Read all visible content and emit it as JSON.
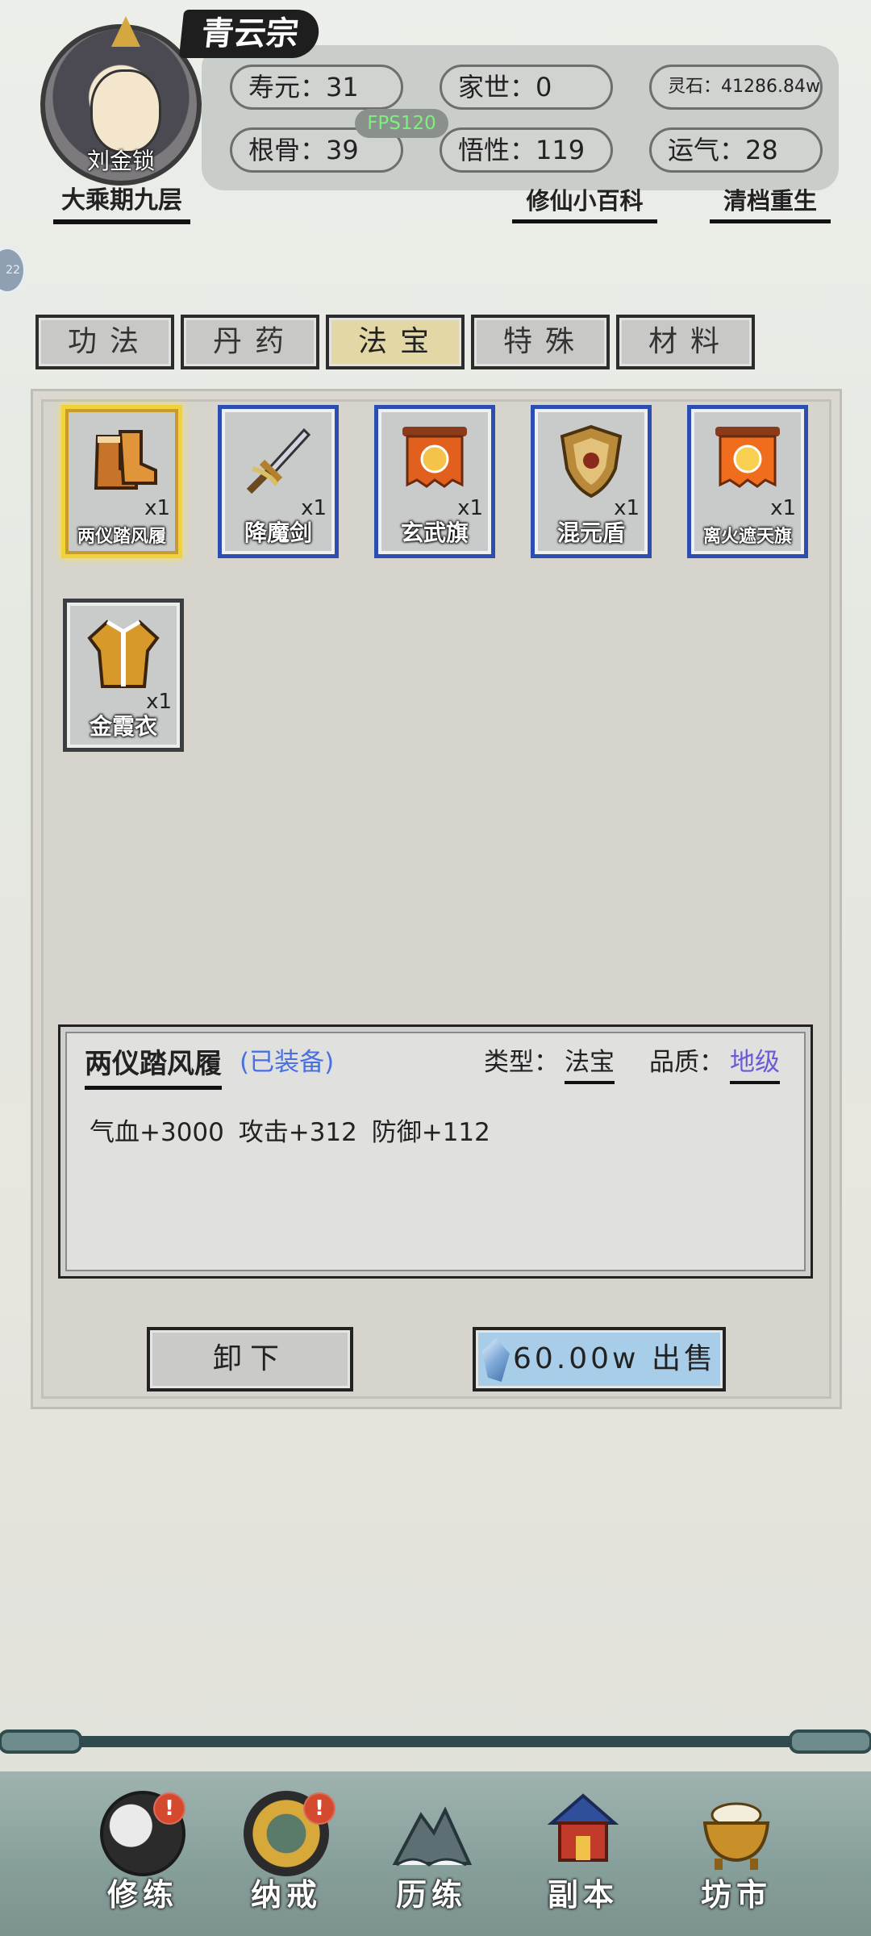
{
  "header": {
    "sect": "青云宗",
    "player_name": "刘金锁",
    "rank": "大乘期九层",
    "fps": "FPS120",
    "stats": {
      "lifespan": "寿元：31",
      "family": "家世：0",
      "spirit_stones": "灵石：41286.84w",
      "bone": "根骨：39",
      "comprehension": "悟性：119",
      "luck": "运气：28"
    },
    "links": {
      "encyclopedia": "修仙小百科",
      "rebirth": "清档重生"
    },
    "side_badge": "22"
  },
  "tabs": [
    {
      "label": "功法"
    },
    {
      "label": "丹药"
    },
    {
      "label": "法宝",
      "active": true
    },
    {
      "label": "特殊"
    },
    {
      "label": "材料"
    }
  ],
  "items": [
    {
      "name": "两仪踏风履",
      "qty": "x1",
      "icon": "boots-icon",
      "frame": "gold",
      "selected": true
    },
    {
      "name": "降魔剑",
      "qty": "x1",
      "icon": "sword-icon",
      "frame": "blue"
    },
    {
      "name": "玄武旗",
      "qty": "x1",
      "icon": "banner-icon",
      "frame": "blue"
    },
    {
      "name": "混元盾",
      "qty": "x1",
      "icon": "shield-icon",
      "frame": "blue"
    },
    {
      "name": "离火遮天旗",
      "qty": "x1",
      "icon": "banner-icon",
      "frame": "blue"
    },
    {
      "name": "金霞衣",
      "qty": "x1",
      "icon": "robe-icon",
      "frame": "gray"
    }
  ],
  "detail": {
    "name": "两仪踏风履",
    "equipped": "(已装备)",
    "type_label": "类型：",
    "type_value": "法宝",
    "quality_label": "品质：",
    "quality_value": "地级",
    "attributes": "气血+3000  攻击+312  防御+112"
  },
  "actions": {
    "unequip": "卸下",
    "sell_price": "60.00w",
    "sell_label": "出售"
  },
  "nav": [
    {
      "label": "修练",
      "icon": "taiji-icon",
      "alert": "!"
    },
    {
      "label": "纳戒",
      "icon": "ring-icon",
      "alert": "!"
    },
    {
      "label": "历练",
      "icon": "mountain-icon"
    },
    {
      "label": "副本",
      "icon": "pagoda-icon"
    },
    {
      "label": "坊市",
      "icon": "cauldron-icon"
    }
  ],
  "colors": {
    "accent_gold": "#f2d23a",
    "item_blue": "#2b4eb0",
    "equipped_blue": "#4a70e0",
    "quality_purple": "#6a5bd8",
    "alert_red": "#d34a2f"
  }
}
